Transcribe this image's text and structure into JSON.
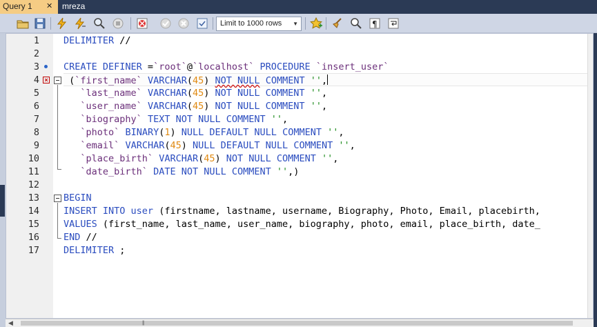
{
  "tabs": [
    {
      "label": "Query 1",
      "close": "✕"
    },
    {
      "label": "mreza"
    }
  ],
  "toolbar": {
    "limit_select": "Limit to 1000 rows"
  },
  "editor": {
    "line_numbers": [
      "1",
      "2",
      "3",
      "4",
      "5",
      "6",
      "7",
      "8",
      "9",
      "10",
      "11",
      "12",
      "13",
      "14",
      "15",
      "16",
      "17"
    ],
    "lines": [
      "DELIMITER //",
      "",
      "CREATE DEFINER =`root`@`localhost` PROCEDURE `insert_user`",
      "(`first_name` VARCHAR(45) NOT NULL COMMENT '',",
      " `last_name` VARCHAR(45) NOT NULL COMMENT '',",
      " `user_name` VARCHAR(45) NOT NULL COMMENT '',",
      " `biography` TEXT NOT NULL COMMENT '',",
      " `photo` BINARY(1) NULL DEFAULT NULL COMMENT '',",
      " `email` VARCHAR(45) NULL DEFAULT NULL COMMENT '',",
      " `place_birth` VARCHAR(45) NOT NULL COMMENT '',",
      " `date_birth` DATE NOT NULL COMMENT '',)",
      "",
      "BEGIN",
      "INSERT INTO user (firstname, lastname, username, Biography, Photo, Email, placebirth,",
      "VALUES (first_name, last_name, user_name, biography, photo, email, place_birth, date_",
      "END //",
      "DELIMITER ;"
    ]
  },
  "colors": {
    "keyword": "#2a4cbf",
    "identifier": "#6b2f7a",
    "number": "#e08a12",
    "string": "#1a8a1a",
    "active_tab": "#f5cc84"
  }
}
